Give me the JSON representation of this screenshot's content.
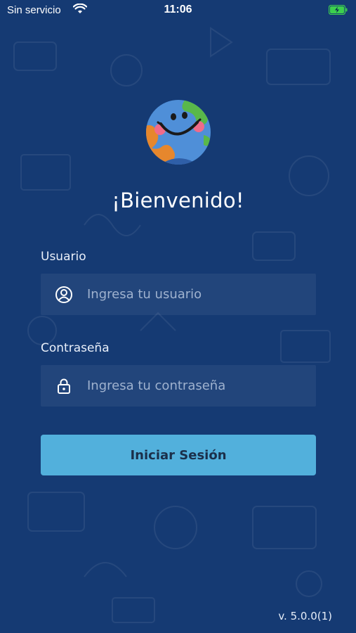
{
  "status_bar": {
    "carrier": "Sin servicio",
    "time": "11:06",
    "battery_color": "#3ccf4e"
  },
  "app": {
    "background_color": "#153a73",
    "accent_color": "#52b0dc",
    "logo": "smiling-globe-logo"
  },
  "login": {
    "title": "¡Bienvenido!",
    "username": {
      "label": "Usuario",
      "placeholder": "Ingresa tu usuario",
      "value": "",
      "icon": "user-circle-icon"
    },
    "password": {
      "label": "Contraseña",
      "placeholder": "Ingresa tu contraseña",
      "value": "",
      "icon": "lock-icon"
    },
    "submit_label": "Iniciar Sesión"
  },
  "footer": {
    "version": "v. 5.0.0(1)"
  }
}
